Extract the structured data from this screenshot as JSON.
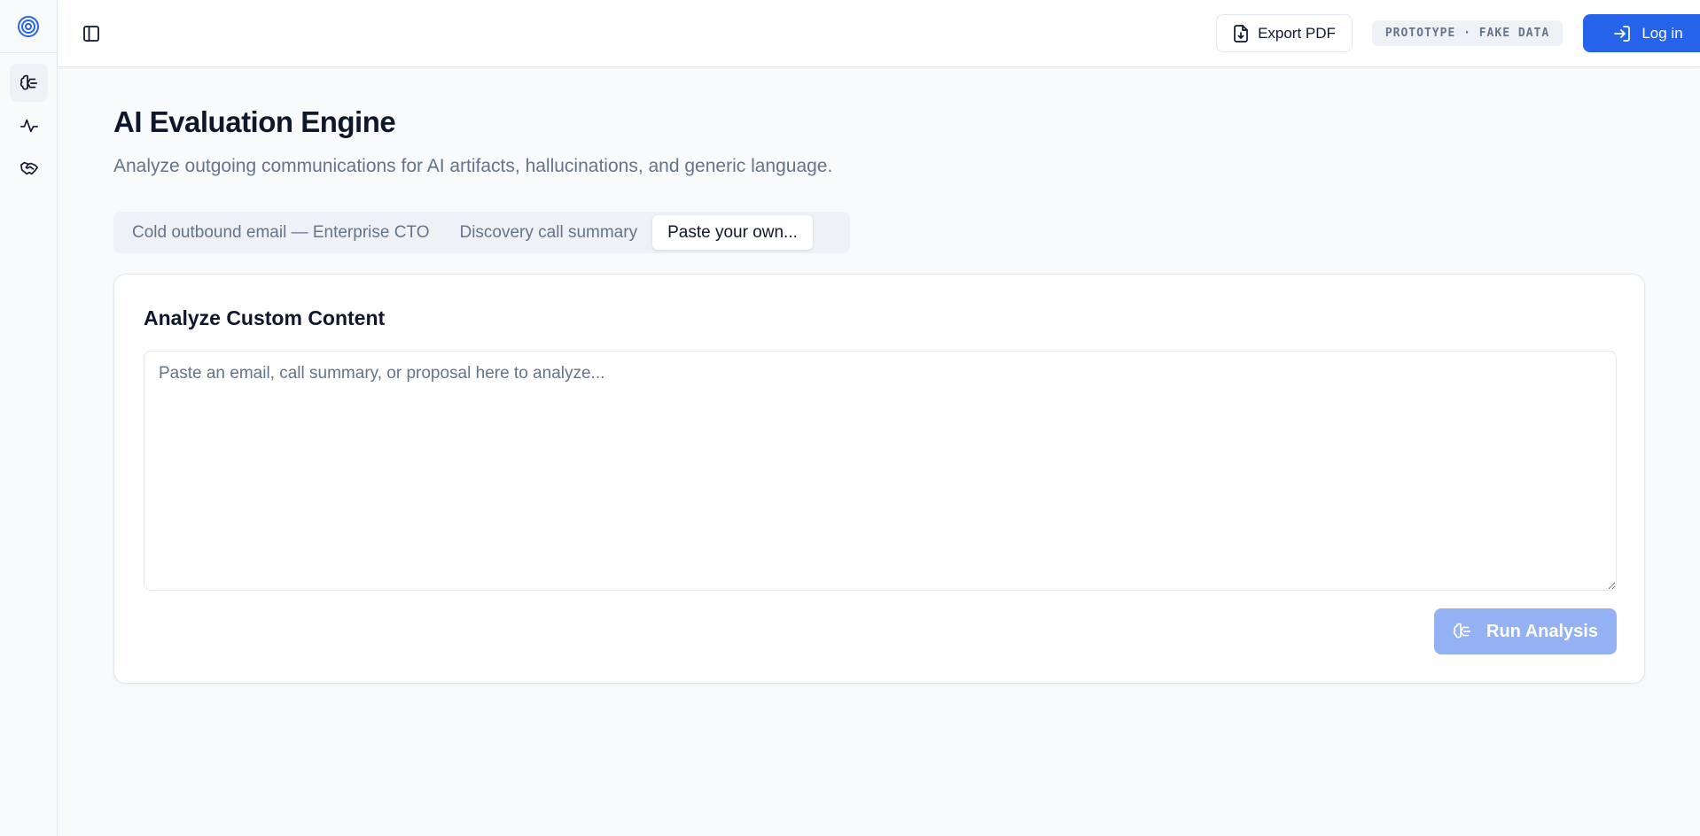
{
  "header": {
    "export_label": "Export PDF",
    "badge_label": "PROTOTYPE · FAKE DATA",
    "login_label": "Log in"
  },
  "page": {
    "title": "AI Evaluation Engine",
    "subtitle": "Analyze outgoing communications for AI artifacts, hallucinations, and generic language."
  },
  "tabs": [
    {
      "label": "Cold outbound email — Enterprise CTO",
      "active": false
    },
    {
      "label": "Discovery call summary",
      "active": false
    },
    {
      "label": "Paste your own...",
      "active": true
    }
  ],
  "card": {
    "title": "Analyze Custom Content",
    "input_placeholder": "Paste an email, call summary, or proposal here to analyze...",
    "input_value": "",
    "run_label": "Run Analysis",
    "run_disabled": true
  },
  "rail": {
    "items": [
      "brain-icon",
      "activity-icon",
      "handshake-icon"
    ],
    "active_item": "brain-icon"
  },
  "colors": {
    "accent": "#2563eb",
    "accent_disabled": "#93b1f3",
    "muted_text": "#64748b",
    "background": "#f8fafc"
  }
}
